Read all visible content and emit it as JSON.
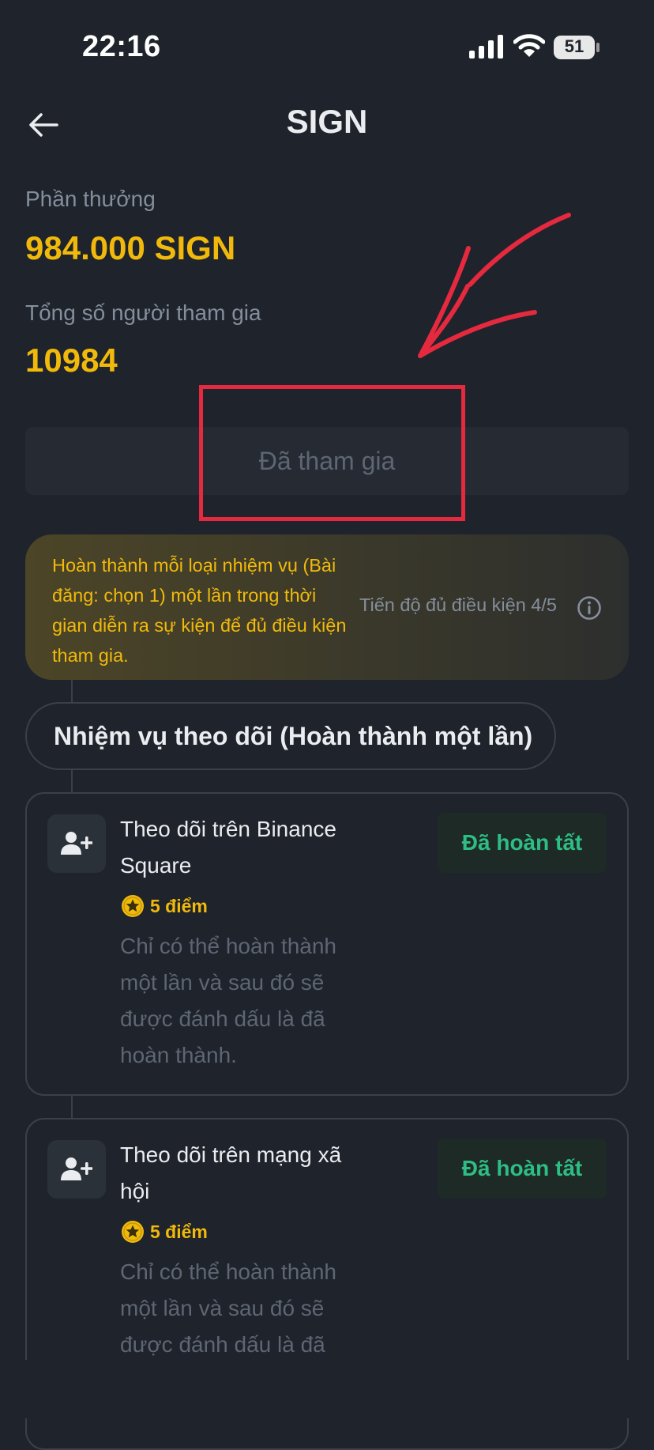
{
  "status_bar": {
    "time": "22:16",
    "battery": "51"
  },
  "header": {
    "title": "SIGN"
  },
  "reward": {
    "label": "Phần thưởng",
    "value": "984.000 SIGN"
  },
  "participants": {
    "label": "Tổng số người tham gia",
    "value": "10984"
  },
  "join_button": {
    "label": "Đã tham gia"
  },
  "info_card": {
    "text": "Hoàn thành mỗi loại nhiệm vụ (Bài đăng: chọn 1) một lần trong thời gian diễn ra sự kiện để đủ điều kiện tham gia.",
    "progress": "Tiến độ đủ điều kiện 4/5"
  },
  "section": {
    "title": "Nhiệm vụ theo dõi (Hoàn thành một lần)"
  },
  "tasks": [
    {
      "title": "Theo dõi trên Binance Square",
      "points": "5 điểm",
      "description": "Chỉ có thể hoàn thành một lần và sau đó sẽ được đánh dấu là đã hoàn thành.",
      "status": "Đã hoàn tất",
      "icon": "add-user-icon"
    },
    {
      "title": "Theo dõi trên mạng xã hội",
      "points": "5 điểm",
      "description": "Chỉ có thể hoàn thành một lần và sau đó sẽ được đánh dấu là đã hoàn thành.",
      "status": "Đã hoàn tất",
      "icon": "add-user-icon"
    }
  ],
  "colors": {
    "background": "#1f232b",
    "accent_yellow": "#f0b90b",
    "success_green": "#2ebd85",
    "annotation_red": "#e5293e"
  }
}
